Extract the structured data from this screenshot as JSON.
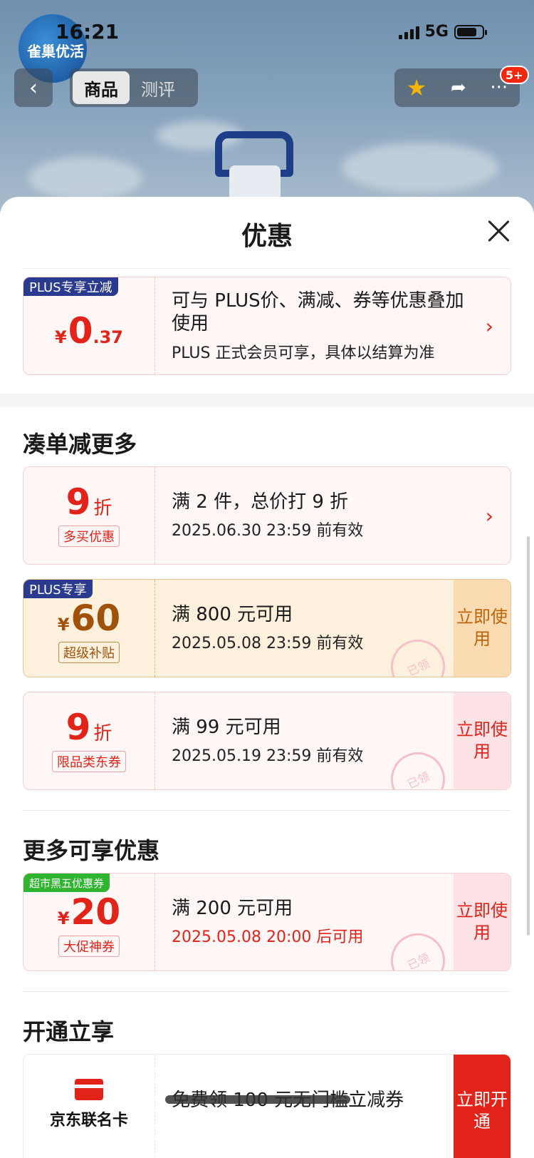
{
  "status_bar": {
    "time": "16:21",
    "network": "5G"
  },
  "brand_logo_text": "雀巢优活",
  "nav": {
    "tab_goods": "商品",
    "tab_review": "测评",
    "badge": "5+"
  },
  "sheet": {
    "title": "优惠",
    "plus_card": {
      "tag": "PLUS专享立减",
      "currency": "¥",
      "amount_int": "0",
      "amount_dec": ".37",
      "main": "可与 PLUS价、满减、券等优惠叠加使用",
      "sub": "PLUS 正式会员可享，具体以结算为准"
    },
    "section1_title": "凑单减更多",
    "coupons": [
      {
        "value": "9",
        "unit": "折",
        "pill": "多买优惠",
        "main": "满 2 件，总价打 9 折",
        "sub": "2025.06.30 23:59 前有效"
      },
      {
        "tag": "PLUS专享",
        "currency": "¥",
        "value": "60",
        "pill": "超级补贴",
        "main": "满 800 元可用",
        "sub": "2025.05.08 23:59 前有效",
        "action": "立即使用",
        "stamp": "已领"
      },
      {
        "value": "9",
        "unit": "折",
        "pill": "限品类东券",
        "main": "满 99 元可用",
        "sub": "2025.05.19 23:59 前有效",
        "action": "立即使用",
        "stamp": "已领"
      }
    ],
    "section2_title": "更多可享优惠",
    "more_coupon": {
      "tag": "超市黑五优惠券",
      "currency": "¥",
      "value": "20",
      "pill": "大促神券",
      "main": "满 200 元可用",
      "sub": "2025.05.08 20:00 后可用",
      "action": "立即使用",
      "stamp": "已领"
    },
    "section3_title": "开通立享",
    "member_card": {
      "label": "京东联名卡",
      "main": "免费领 100 元无门槛立减券",
      "action": "立即开通"
    }
  },
  "colors": {
    "accent_red": "#e2231a",
    "gold": "#a0520a",
    "plus_blue": "#2a3a8f"
  }
}
